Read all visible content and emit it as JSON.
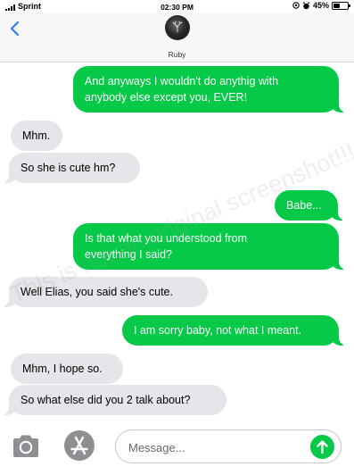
{
  "status_bar": {
    "carrier": "Sprint",
    "time": "02:30 PM",
    "battery_text": "45%",
    "battery_level": 0.45
  },
  "header": {
    "contact_name": "Ruby"
  },
  "messages": [
    {
      "direction": "sent",
      "text_lines": [
        "And anyways I wouldn't do anythig with",
        "anybody else except you, EVER!"
      ]
    },
    {
      "direction": "received",
      "text_lines": [
        "Mhm."
      ]
    },
    {
      "direction": "received",
      "text_lines": [
        "So she is cute hm?"
      ]
    },
    {
      "direction": "sent",
      "text_lines": [
        "Babe..."
      ]
    },
    {
      "direction": "sent",
      "text_lines": [
        "Is that what you understood from",
        "everything I said?"
      ]
    },
    {
      "direction": "received",
      "text_lines": [
        "Well Elias, you said she's cute."
      ]
    },
    {
      "direction": "sent",
      "text_lines": [
        "I am sorry baby, not what I meant."
      ]
    },
    {
      "direction": "received",
      "text_lines": [
        "Mhm, I hope so."
      ]
    },
    {
      "direction": "received",
      "text_lines": [
        "So what else did you 2 talk about?"
      ]
    }
  ],
  "watermark": "This is not an original screenshot!!!",
  "composer": {
    "placeholder": "Message..."
  },
  "colors": {
    "sent_bubble": "#05c947",
    "received_bubble": "#e5e5ea",
    "back_chevron": "#2f7cf6"
  },
  "icons": {
    "back": "chevron-left-icon",
    "camera": "camera-icon",
    "apps": "app-store-icon",
    "send": "send-arrow-icon"
  }
}
